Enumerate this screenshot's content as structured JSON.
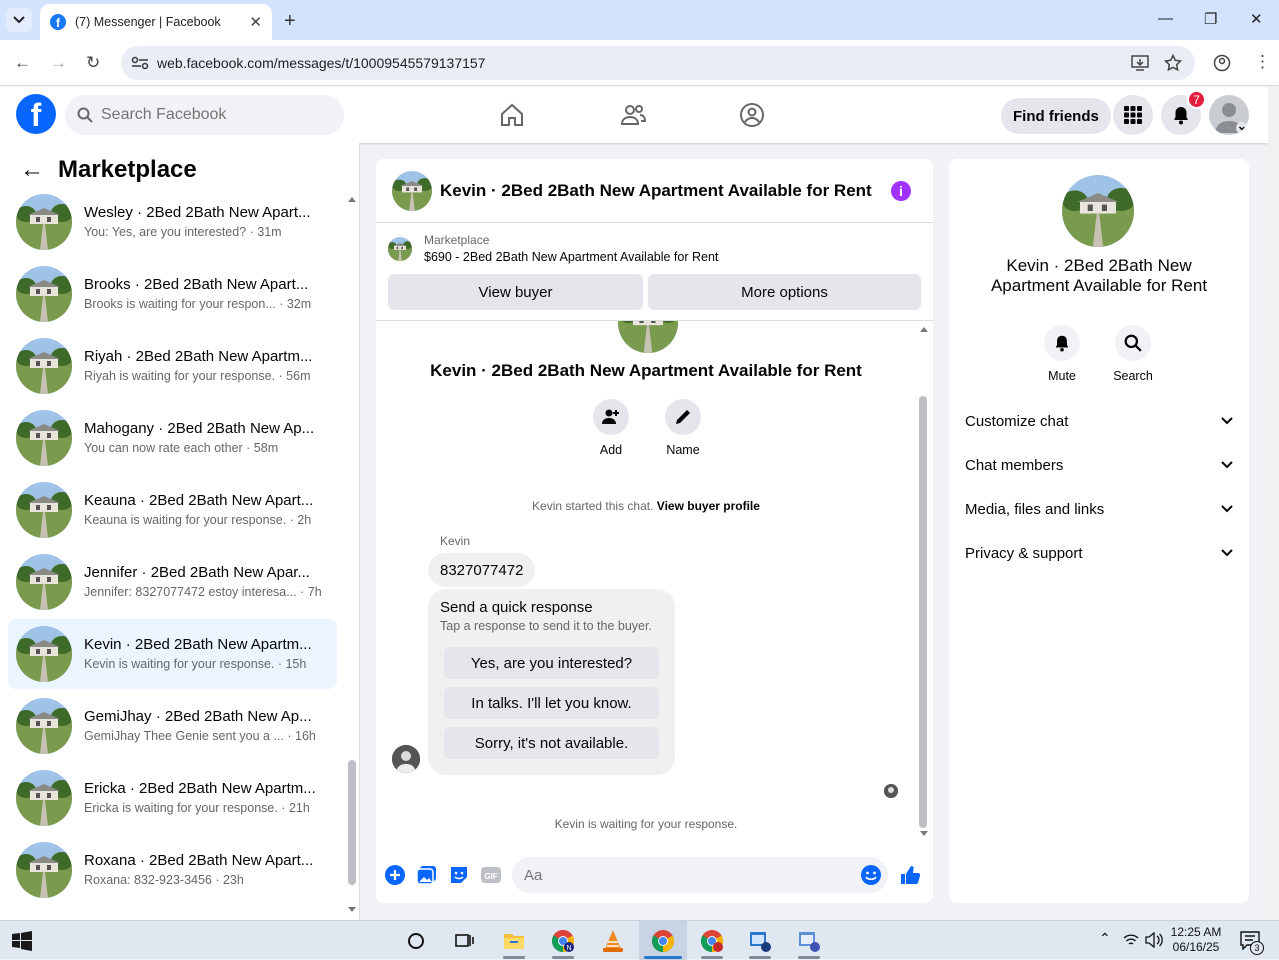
{
  "browser": {
    "tab_title": "(7) Messenger | Facebook",
    "url": "web.facebook.com/messages/t/10009545579137157"
  },
  "header": {
    "search_placeholder": "Search Facebook",
    "find_friends": "Find friends",
    "notification_count": "7"
  },
  "sidebar": {
    "title": "Marketplace",
    "conversations": [
      {
        "name": "Wesley · 2Bed 2Bath New Apart...",
        "snippet": "You: Yes, are you interested? · 31m",
        "active": false
      },
      {
        "name": "Brooks · 2Bed 2Bath New Apart...",
        "snippet": "Brooks is waiting for your respon... · 32m",
        "active": false
      },
      {
        "name": "Riyah · 2Bed 2Bath New Apartm...",
        "snippet": "Riyah is waiting for your response. · 56m",
        "active": false
      },
      {
        "name": "Mahogany · 2Bed 2Bath New Ap...",
        "snippet": "You can now rate each other · 58m",
        "active": false
      },
      {
        "name": "Keauna · 2Bed 2Bath New Apart...",
        "snippet": "Keauna is waiting for your response. · 2h",
        "active": false
      },
      {
        "name": "Jennifer · 2Bed 2Bath New Apar...",
        "snippet": "Jennifer: 8327077472 estoy interesa... · 7h",
        "active": false
      },
      {
        "name": "Kevin · 2Bed 2Bath New Apartm...",
        "snippet": "Kevin is waiting for your response. · 15h",
        "active": true
      },
      {
        "name": "GemiJhay · 2Bed 2Bath New Ap...",
        "snippet": "GemiJhay Thee Genie sent you a ... · 16h",
        "active": false
      },
      {
        "name": "Ericka · 2Bed 2Bath New Apartm...",
        "snippet": "Ericka is waiting for your response. · 21h",
        "active": false
      },
      {
        "name": "Roxana · 2Bed 2Bath New Apart...",
        "snippet": "Roxana: 832-923-3456 · 23h",
        "active": false
      }
    ]
  },
  "chat": {
    "title": "Kevin · 2Bed 2Bath New Apartment Available for Rent",
    "marketplace_label": "Marketplace",
    "listing": "$690 - 2Bed 2Bath New Apartment Available for Rent",
    "view_buyer": "View buyer",
    "more_options": "More options",
    "add_label": "Add",
    "name_label": "Name",
    "started_text": "Kevin started this chat.",
    "view_buyer_profile": "View buyer profile",
    "sender": "Kevin",
    "message": "8327077472",
    "quick_title": "Send a quick response",
    "quick_sub": "Tap a response to send it to the buyer.",
    "quick_responses": [
      "Yes, are you interested?",
      "In talks. I'll let you know.",
      "Sorry, it's not available."
    ],
    "waiting": "Kevin is waiting for your response.",
    "composer_placeholder": "Aa"
  },
  "info_panel": {
    "title": "Kevin · 2Bed 2Bath New Apartment Available for Rent",
    "mute": "Mute",
    "search": "Search",
    "sections": [
      "Customize chat",
      "Chat members",
      "Media, files and links",
      "Privacy & support"
    ]
  },
  "taskbar": {
    "time": "12:25 AM",
    "date": "06/16/25",
    "notif_count": "3"
  },
  "colors": {
    "fb_blue": "#0866ff",
    "active_conv": "#ebf5ff",
    "info_purple": "#a033ff",
    "badge_red": "#e41e3f"
  }
}
